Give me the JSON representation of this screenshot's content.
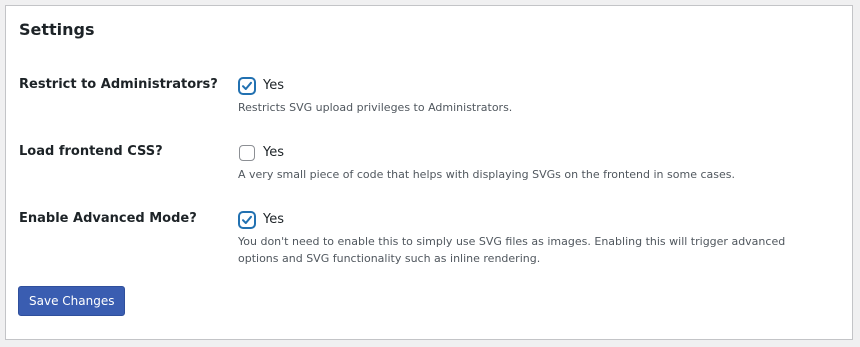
{
  "panel": {
    "title": "Settings"
  },
  "settings": [
    {
      "label": "Restrict to Administrators?",
      "checkbox_label": "Yes",
      "checked": true,
      "description": "Restricts SVG upload privileges to Administrators."
    },
    {
      "label": "Load frontend CSS?",
      "checkbox_label": "Yes",
      "checked": false,
      "description": "A very small piece of code that helps with displaying SVGs on the frontend in some cases."
    },
    {
      "label": "Enable Advanced Mode?",
      "checkbox_label": "Yes",
      "checked": true,
      "description": "You don't need to enable this to simply use SVG files as images. Enabling this will trigger advanced options and SVG functionality such as inline rendering."
    }
  ],
  "actions": {
    "save_label": "Save Changes"
  },
  "colors": {
    "page_background": "#f0f0f1",
    "panel_background": "#ffffff",
    "accent": "#2271b1",
    "button_background": "#3a5db1",
    "description_text": "#50575e"
  }
}
